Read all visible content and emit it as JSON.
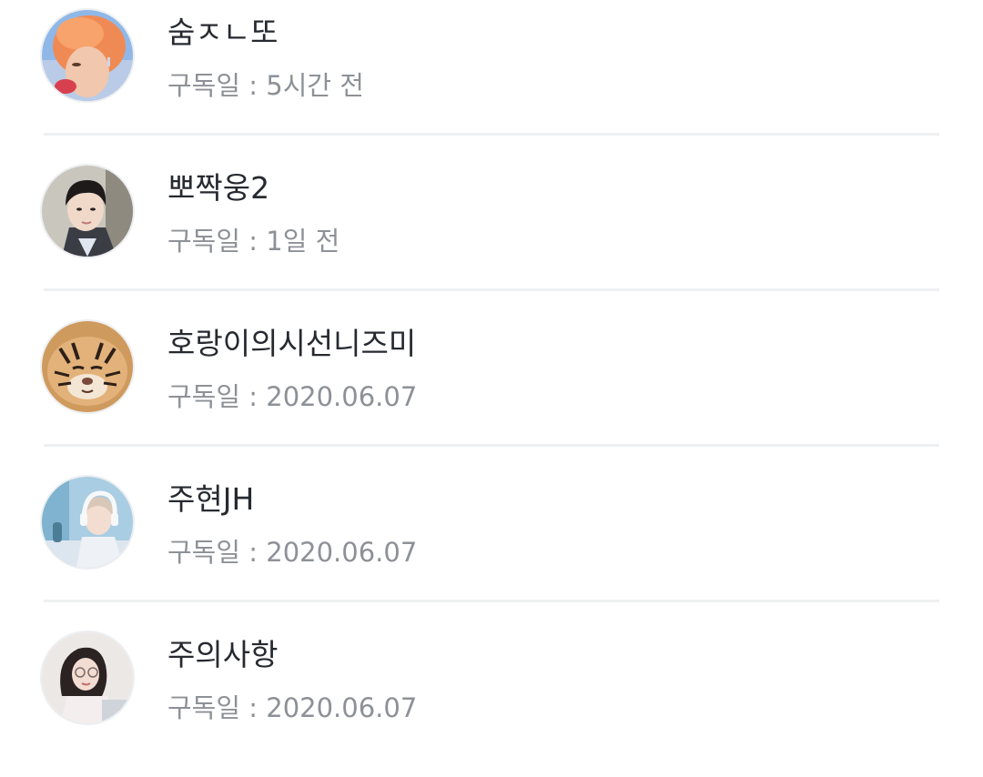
{
  "subscribers": [
    {
      "name": "숨ㅈㄴ또",
      "date_label": "구독일 : 5시간 전",
      "avatar_icon": "avatar-orange-hair-person"
    },
    {
      "name": "뽀짝웅2",
      "date_label": "구독일 : 1일 전",
      "avatar_icon": "avatar-dark-hair-person"
    },
    {
      "name": "호랑이의시선니즈미",
      "date_label": "구독일 : 2020.06.07",
      "avatar_icon": "avatar-tiger"
    },
    {
      "name": "주현JH",
      "date_label": "구독일 : 2020.06.07",
      "avatar_icon": "avatar-headphones-person"
    },
    {
      "name": "주의사항",
      "date_label": "구독일 : 2020.06.07",
      "avatar_icon": "avatar-glasses-person"
    }
  ],
  "colors": {
    "name_text": "#262a30",
    "date_text": "#8d9197",
    "divider": "#eef0f2"
  }
}
